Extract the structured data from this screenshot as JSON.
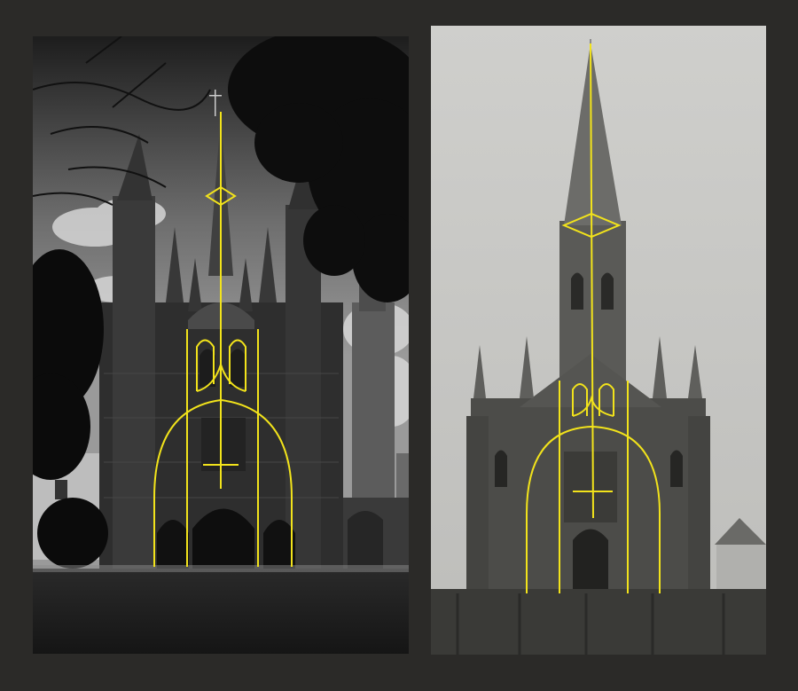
{
  "figure": {
    "left_photo": {
      "subject": "church-facade-photo",
      "tone": "grayscale",
      "overlay_color": "#f2e31b"
    },
    "right_photo": {
      "subject": "church-archival-photo",
      "tone": "grayscale",
      "overlay_color": "#f2e31b"
    },
    "colors": {
      "background": "#2b2a28",
      "overlay": "#f2e31b"
    }
  }
}
